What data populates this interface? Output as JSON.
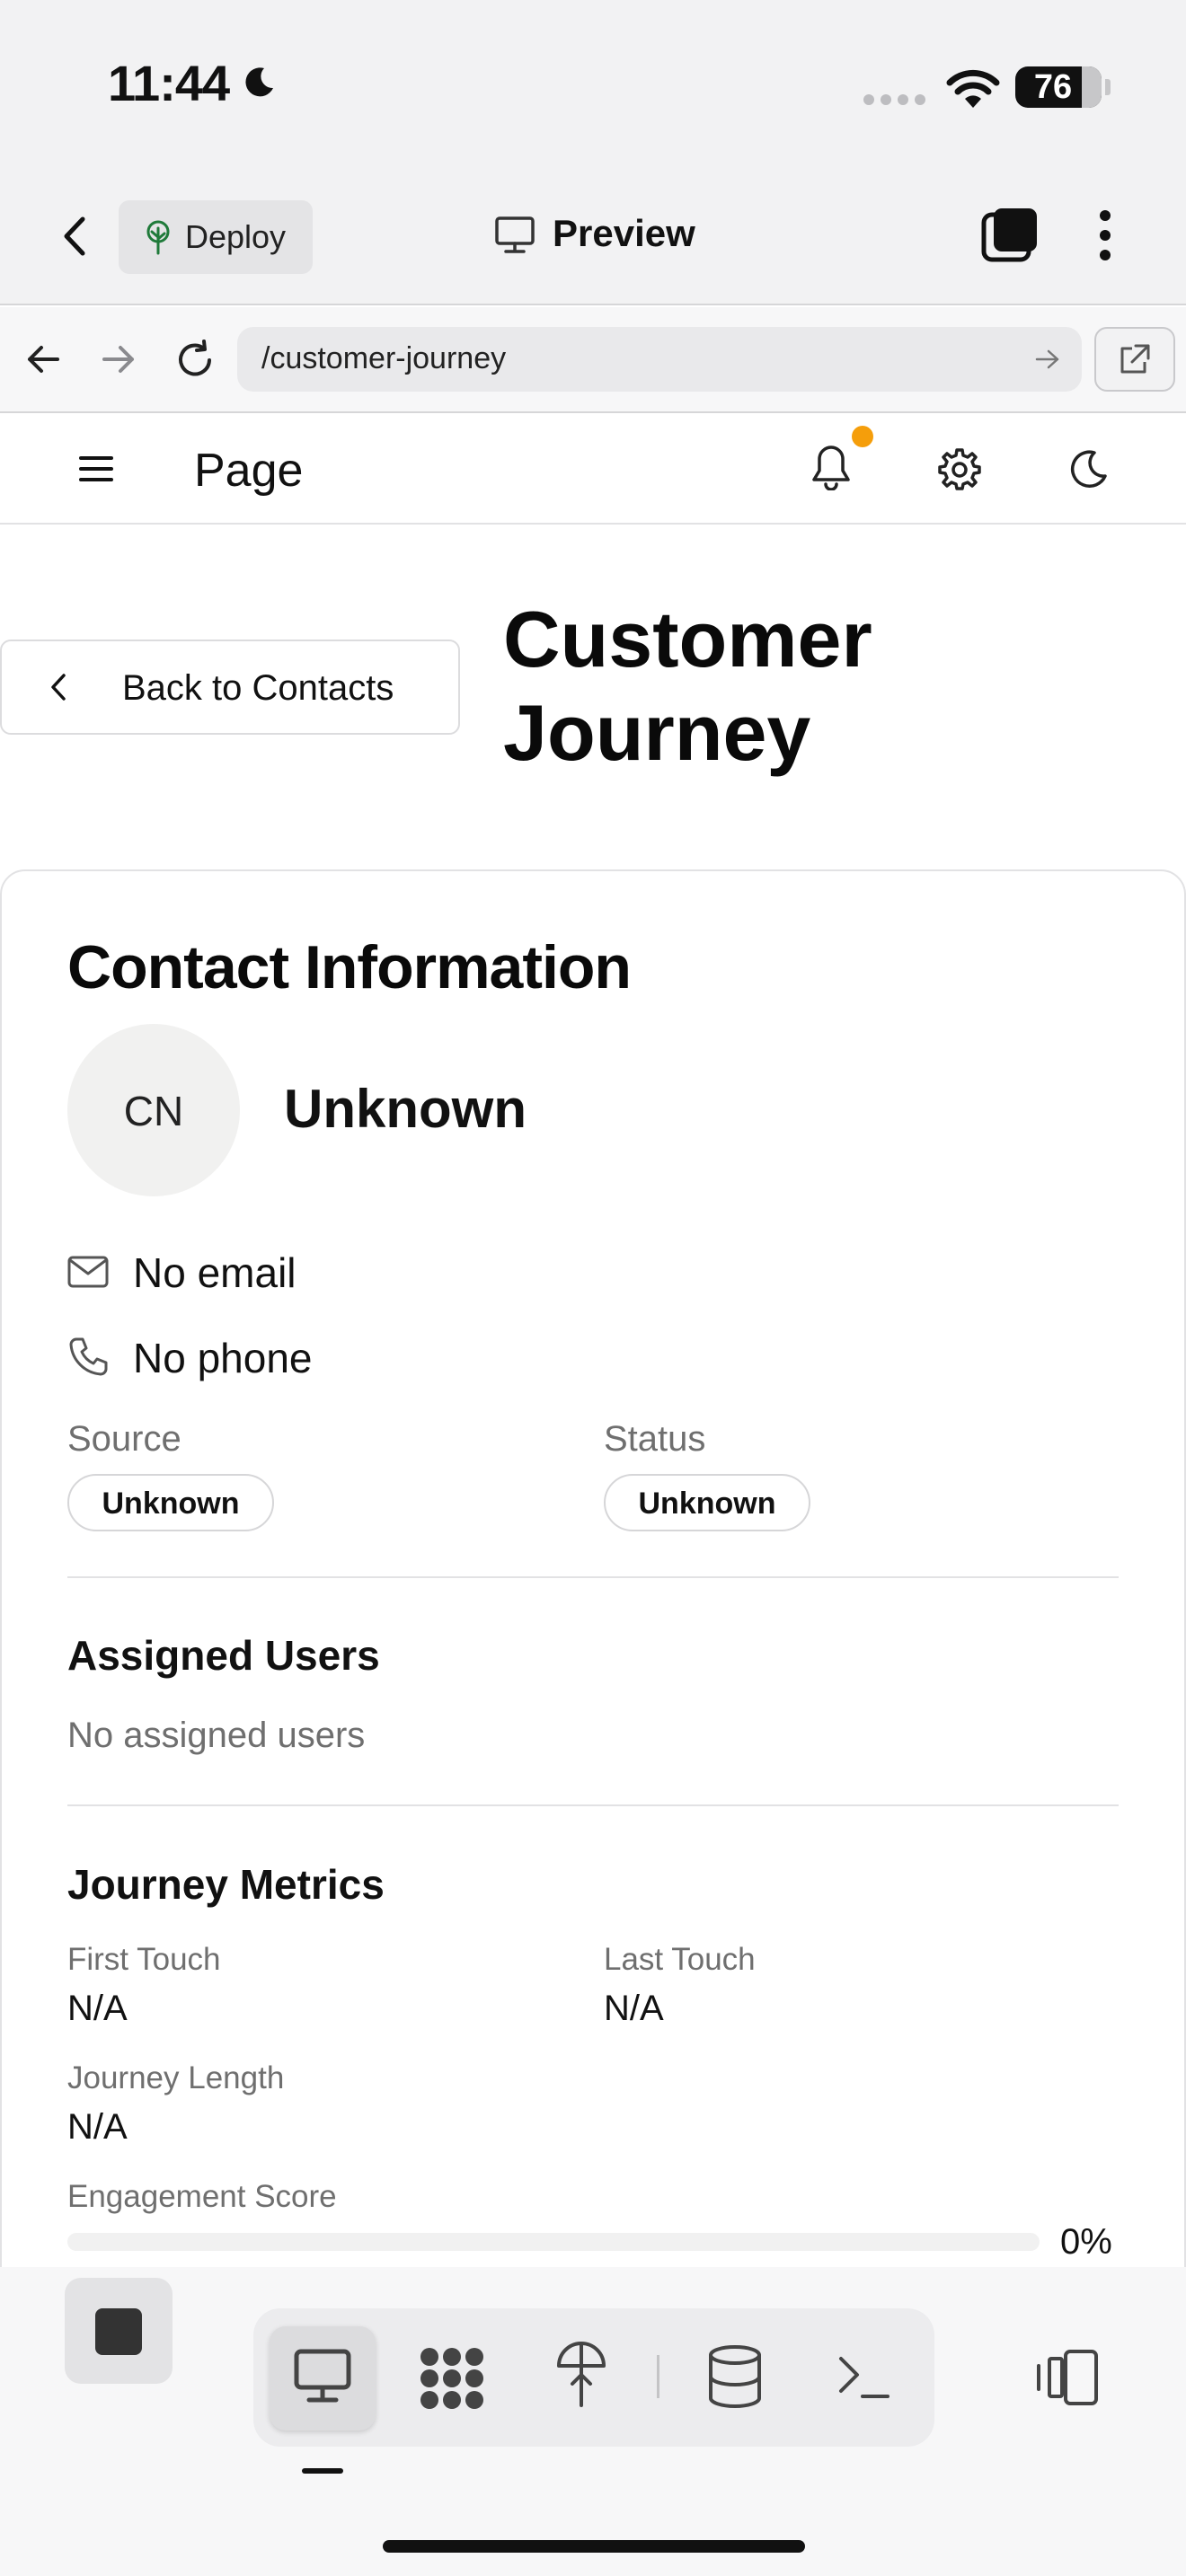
{
  "status_bar": {
    "time": "11:44",
    "battery": "76"
  },
  "app_bar": {
    "deploy_label": "Deploy",
    "preview_label": "Preview"
  },
  "browser": {
    "url": "/customer-journey"
  },
  "page_header": {
    "title": "Page"
  },
  "back_button": {
    "label": "Back to Contacts"
  },
  "heading": {
    "title": "Customer Journey"
  },
  "contact": {
    "section_title": "Contact Information",
    "avatar_initials": "CN",
    "name": "Unknown",
    "email": "No email",
    "phone": "No phone",
    "source_label": "Source",
    "source_value": "Unknown",
    "status_label": "Status",
    "status_value": "Unknown"
  },
  "assigned": {
    "title": "Assigned Users",
    "empty": "No assigned users"
  },
  "metrics": {
    "title": "Journey Metrics",
    "first_touch_label": "First Touch",
    "first_touch_value": "N/A",
    "last_touch_label": "Last Touch",
    "last_touch_value": "N/A",
    "journey_length_label": "Journey Length",
    "journey_length_value": "N/A",
    "engagement_label": "Engagement Score",
    "engagement_value": "0%",
    "engagement_fraction": 0
  },
  "colors": {
    "notification_dot": "#f59e0b",
    "deploy_icon": "#1f7a3a"
  },
  "icons": {
    "status": [
      "moon-icon",
      "signal-icon",
      "wifi-icon",
      "battery-icon"
    ],
    "app_bar": [
      "chevron-left-icon",
      "tree-icon",
      "monitor-icon",
      "tabs-icon",
      "more-vertical-icon"
    ],
    "browser": [
      "arrow-left-icon",
      "arrow-right-icon",
      "reload-icon",
      "go-icon",
      "external-link-icon"
    ],
    "page_header": [
      "menu-icon",
      "bell-icon",
      "gear-icon",
      "moon-icon"
    ],
    "contact": [
      "mail-icon",
      "phone-icon"
    ],
    "bottom_bar": [
      "stop-icon",
      "monitor-icon",
      "grid-icon",
      "deploy-icon",
      "database-icon",
      "terminal-icon",
      "device-toggle-icon"
    ]
  }
}
